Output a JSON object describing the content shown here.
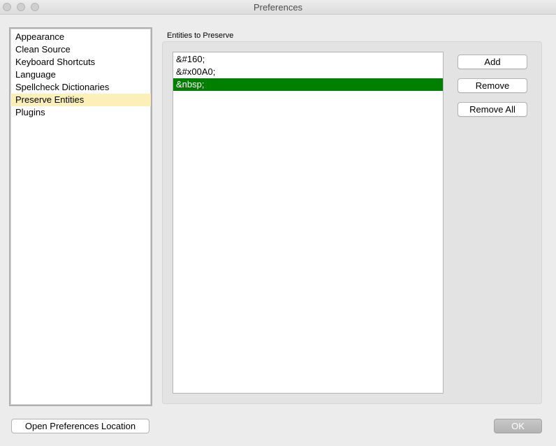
{
  "window": {
    "title": "Preferences"
  },
  "sidebar": {
    "items": [
      {
        "label": "Appearance",
        "selected": false
      },
      {
        "label": "Clean Source",
        "selected": false
      },
      {
        "label": "Keyboard Shortcuts",
        "selected": false
      },
      {
        "label": "Language",
        "selected": false
      },
      {
        "label": "Spellcheck Dictionaries",
        "selected": false
      },
      {
        "label": "Preserve Entities",
        "selected": true
      },
      {
        "label": "Plugins",
        "selected": false
      }
    ]
  },
  "main": {
    "group_label": "Entities to Preserve",
    "entities": [
      {
        "text": "&#160;",
        "selected": false
      },
      {
        "text": "&#x00A0;",
        "selected": false
      },
      {
        "text": "&nbsp;",
        "selected": true
      }
    ],
    "buttons": {
      "add": "Add",
      "remove": "Remove",
      "remove_all": "Remove All"
    }
  },
  "footer": {
    "open_location": "Open Preferences Location",
    "ok": "OK"
  },
  "colors": {
    "sidebar_selected": "#fdefb8",
    "entity_selected": "#007f00",
    "window_bg": "#ececec"
  }
}
